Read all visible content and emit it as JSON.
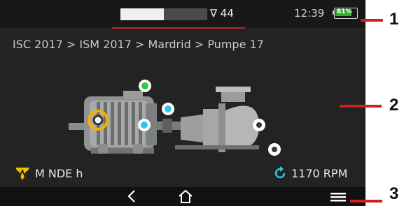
{
  "status_bar": {
    "signal_value": "∇ 44",
    "signal_level": 0.5,
    "time": "12:39",
    "battery_percent": "81%",
    "battery_level": 0.81
  },
  "breadcrumb": "ISC 2017 > ISM 2017 > Mardrid > Pumpe 17",
  "measurement": {
    "label": "M NDE h",
    "rpm": "1170 RPM"
  },
  "callouts": [
    "1",
    "2",
    "3"
  ],
  "colors": {
    "accent_red": "#c81e1e",
    "battery_green": "#2fae2f",
    "sensor_selected": "#f0b400",
    "sensor_green": "#2ecc40",
    "sensor_cyan": "#2ec7e6"
  },
  "icons": {
    "measure": "yellow-vibration-icon",
    "rpm": "rotation-icon",
    "back": "chevron-left-icon",
    "home": "home-icon",
    "menu": "hamburger-menu-icon"
  }
}
